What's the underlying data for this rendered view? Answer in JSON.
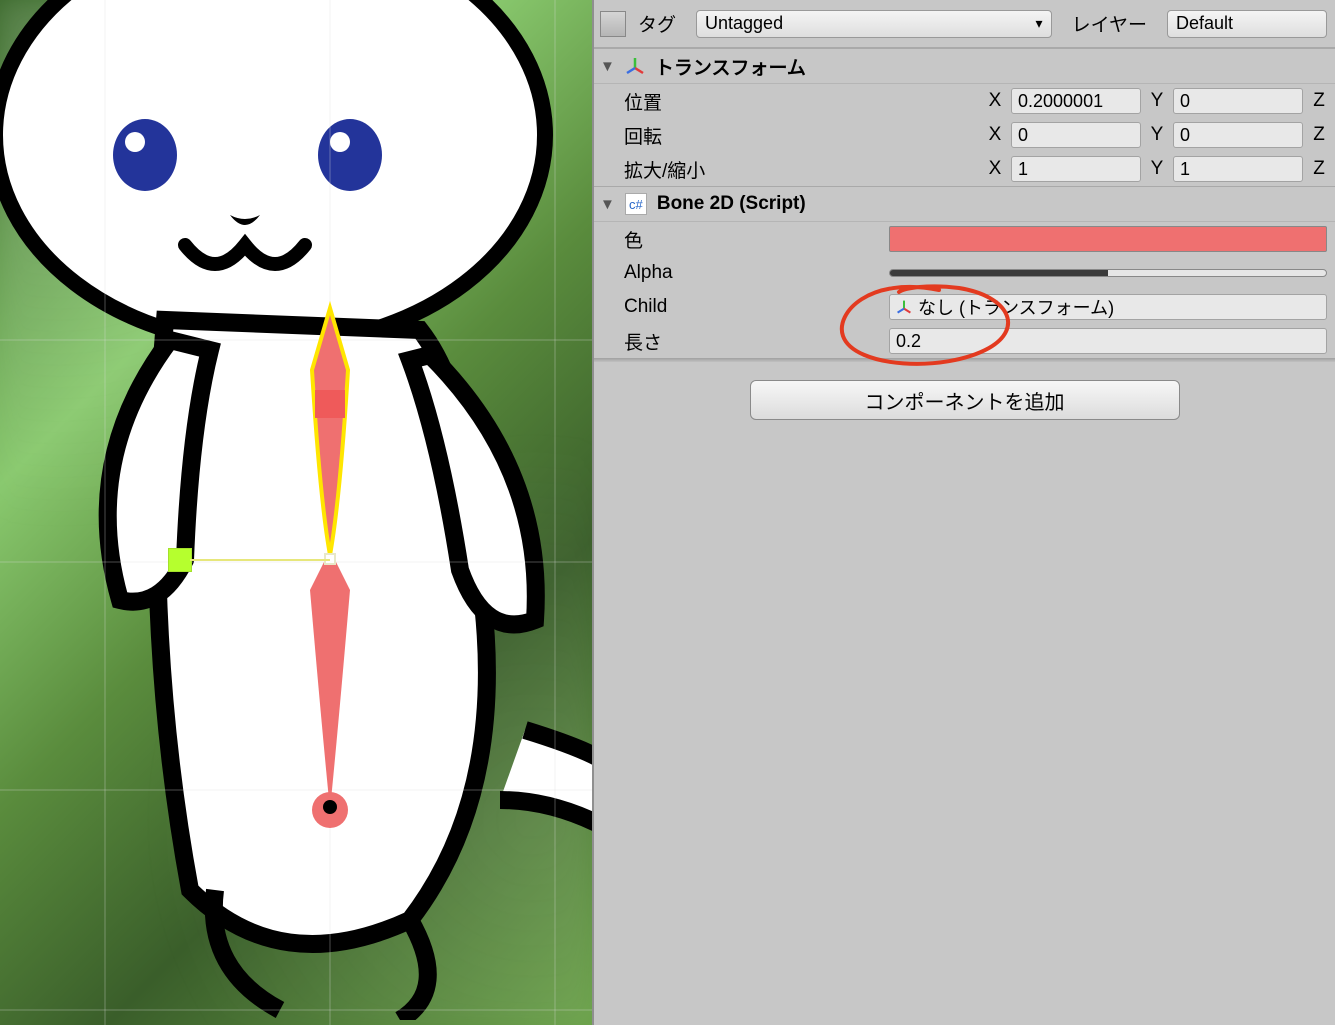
{
  "header": {
    "tag_label": "タグ",
    "tag_value": "Untagged",
    "layer_label": "レイヤー",
    "layer_value": "Default"
  },
  "transform": {
    "title": "トランスフォーム",
    "position_label": "位置",
    "rotation_label": "回転",
    "scale_label": "拡大/縮小",
    "position": {
      "x": "0.2000001",
      "y": "0",
      "z": ""
    },
    "rotation": {
      "x": "0",
      "y": "0",
      "z": ""
    },
    "scale": {
      "x": "1",
      "y": "1",
      "z": ""
    },
    "axis_x": "X",
    "axis_y": "Y",
    "axis_z": "Z"
  },
  "bone2d": {
    "title": "Bone 2D (Script)",
    "color_label": "色",
    "alpha_label": "Alpha",
    "child_label": "Child",
    "child_value": "なし (トランスフォーム)",
    "length_label": "長さ",
    "length_value": "0.2",
    "script_tag": "c#"
  },
  "buttons": {
    "add_component": "コンポーネントを追加"
  }
}
